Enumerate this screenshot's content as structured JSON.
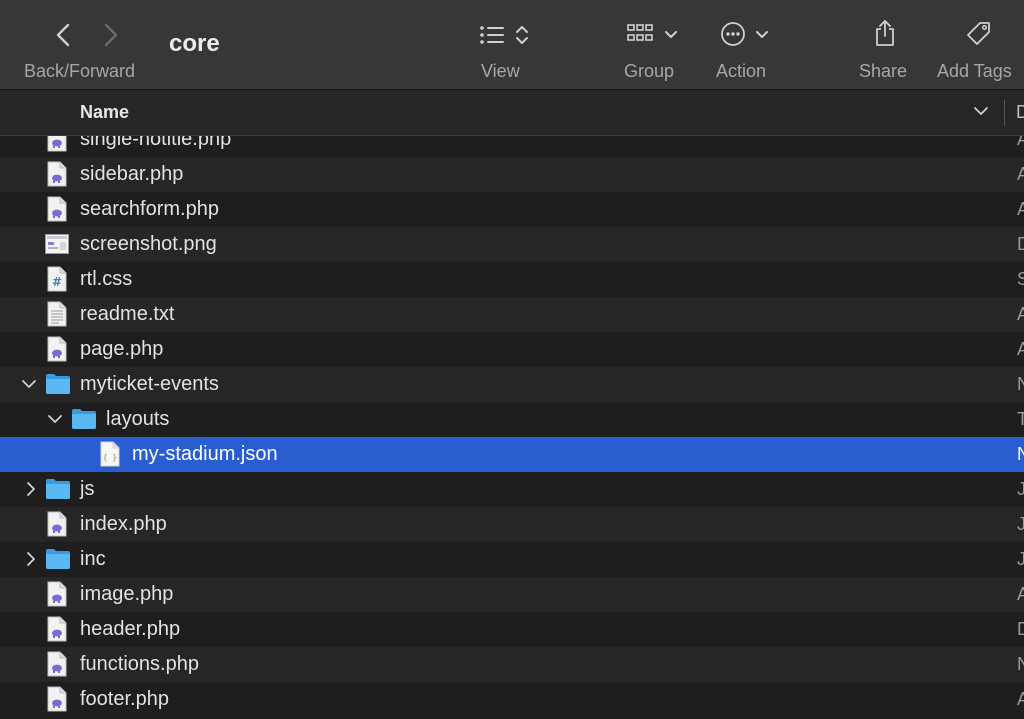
{
  "window": {
    "title": "core"
  },
  "toolbar": {
    "back_forward_label": "Back/Forward",
    "view_label": "View",
    "group_label": "Group",
    "action_label": "Action",
    "share_label": "Share",
    "add_tags_label": "Add Tags"
  },
  "columns": {
    "name": "Name",
    "next_initial": "D"
  },
  "rows": [
    {
      "name": "single-notitle.php",
      "type": "php",
      "tail": "A"
    },
    {
      "name": "sidebar.php",
      "type": "php",
      "tail": "A"
    },
    {
      "name": "searchform.php",
      "type": "php",
      "tail": "A"
    },
    {
      "name": "screenshot.png",
      "type": "png",
      "tail": "D"
    },
    {
      "name": "rtl.css",
      "type": "css",
      "tail": "S"
    },
    {
      "name": "readme.txt",
      "type": "txt",
      "tail": "A"
    },
    {
      "name": "page.php",
      "type": "php",
      "tail": "A"
    },
    {
      "name": "myticket-events",
      "type": "folder",
      "tail": "N",
      "expanded": true
    },
    {
      "name": "layouts",
      "type": "folder",
      "tail": "T",
      "expanded": true
    },
    {
      "name": "my-stadium.json",
      "type": "json",
      "tail": "N",
      "selected": true
    },
    {
      "name": "js",
      "type": "folder",
      "tail": "J",
      "expanded": false
    },
    {
      "name": "index.php",
      "type": "php",
      "tail": "J"
    },
    {
      "name": "inc",
      "type": "folder",
      "tail": "J",
      "expanded": false
    },
    {
      "name": "image.php",
      "type": "php",
      "tail": "A"
    },
    {
      "name": "header.php",
      "type": "php",
      "tail": "D"
    },
    {
      "name": "functions.php",
      "type": "php",
      "tail": "N"
    },
    {
      "name": "footer.php",
      "type": "php",
      "tail": "A"
    }
  ],
  "colors": {
    "toolbar_bg": "#373737",
    "selection": "#2a5ed0",
    "folder": "#3fa8ee",
    "php_elephant": "#7a6bd0"
  }
}
